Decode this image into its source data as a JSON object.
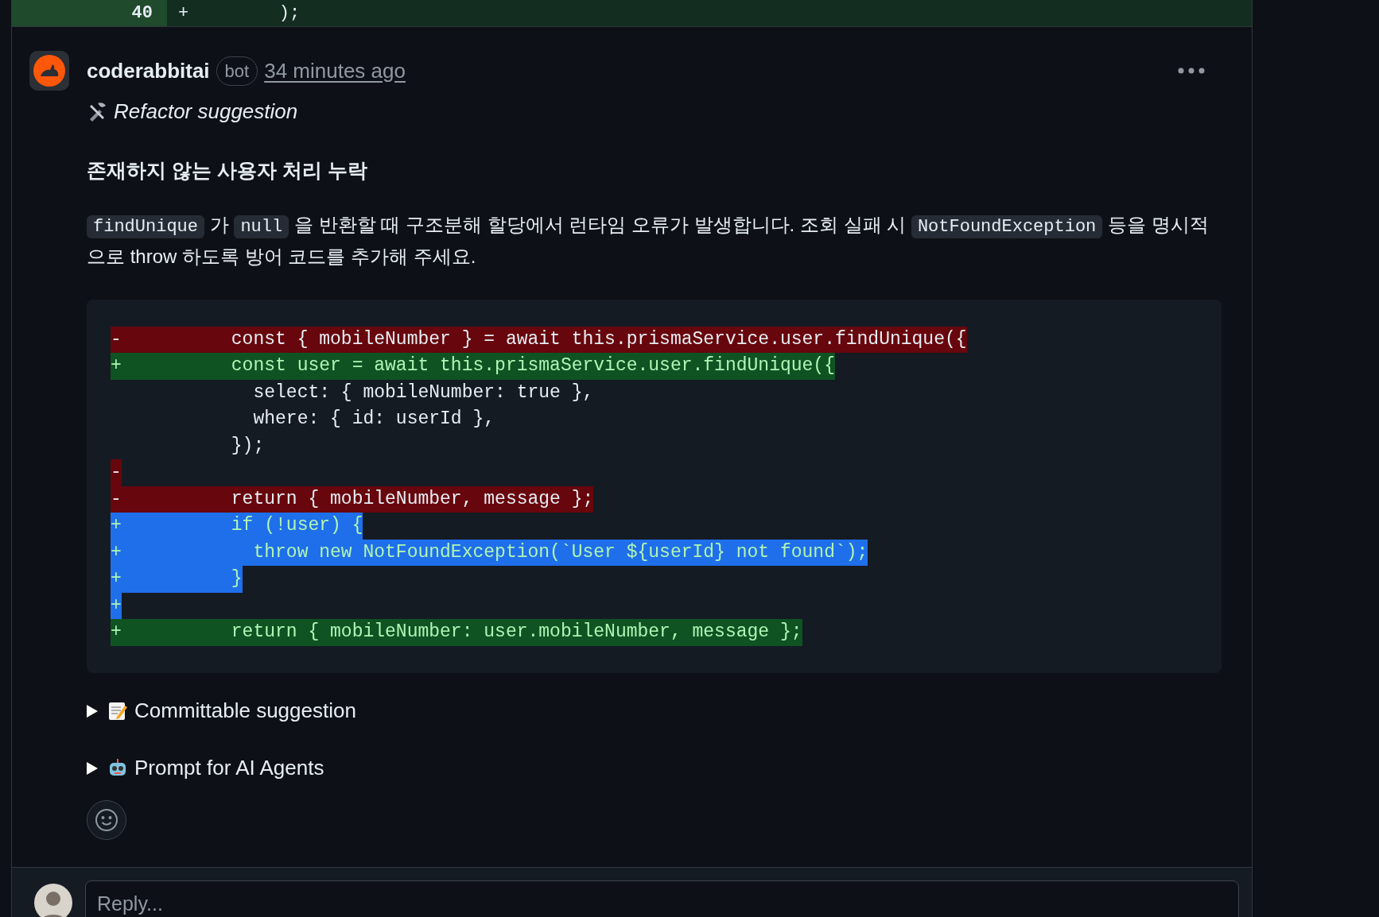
{
  "diff_row": {
    "number": "40",
    "marker": "+",
    "code": "        );"
  },
  "comment": {
    "author": "coderabbitai",
    "badge": "bot",
    "time": "34 minutes ago",
    "label": "Refactor suggestion",
    "heading": "존재하지 않는 사용자 처리 누락",
    "paragraph": [
      {
        "kind": "code",
        "text": "findUnique"
      },
      {
        "kind": "text",
        "text": " 가 "
      },
      {
        "kind": "code",
        "text": "null"
      },
      {
        "kind": "text",
        "text": " 을 반환할 때 구조분해 할당에서 런타임 오류가 발생합니다. 조회 실패 시 "
      },
      {
        "kind": "code",
        "text": "NotFoundException"
      },
      {
        "kind": "text",
        "text": " 등을 명시적으로 throw 하도록 방어 코드를 추가해 주세요."
      }
    ],
    "code_lines": [
      {
        "kind": "del",
        "marker": "-",
        "text": "        const { mobileNumber } = await this.prismaService.user.findUnique({",
        "selected": false
      },
      {
        "kind": "add",
        "marker": "+",
        "text": "        const user = await this.prismaService.user.findUnique({",
        "selected": false
      },
      {
        "kind": "context",
        "text": "          select: { mobileNumber: true },",
        "selected": false
      },
      {
        "kind": "context",
        "text": "          where: { id: userId },",
        "selected": false
      },
      {
        "kind": "context",
        "text": "        });",
        "selected": false
      },
      {
        "kind": "del",
        "marker": "-",
        "selected": false
      },
      {
        "kind": "del",
        "marker": "-",
        "text": "        return { mobileNumber, message };",
        "selected": false
      },
      {
        "kind": "add",
        "marker": "+",
        "text": "        if (!user) {",
        "selected": true
      },
      {
        "kind": "add",
        "marker": "+",
        "text": "          throw new NotFoundException(`User ${userId} not found`);",
        "selected": true
      },
      {
        "kind": "add",
        "marker": "+",
        "text": "        }",
        "selected": true
      },
      {
        "kind": "add",
        "marker": "+",
        "selected": true
      },
      {
        "kind": "add",
        "marker": "+",
        "text": "        return { mobileNumber: user.mobileNumber, message };",
        "selected": false
      }
    ],
    "details": [
      {
        "kind": "memo",
        "summary": "Committable suggestion",
        "expanded": false
      },
      {
        "kind": "robot",
        "summary": "Prompt for AI Agents",
        "expanded": false
      }
    ]
  },
  "reply": {
    "placeholder": "Reply..."
  }
}
